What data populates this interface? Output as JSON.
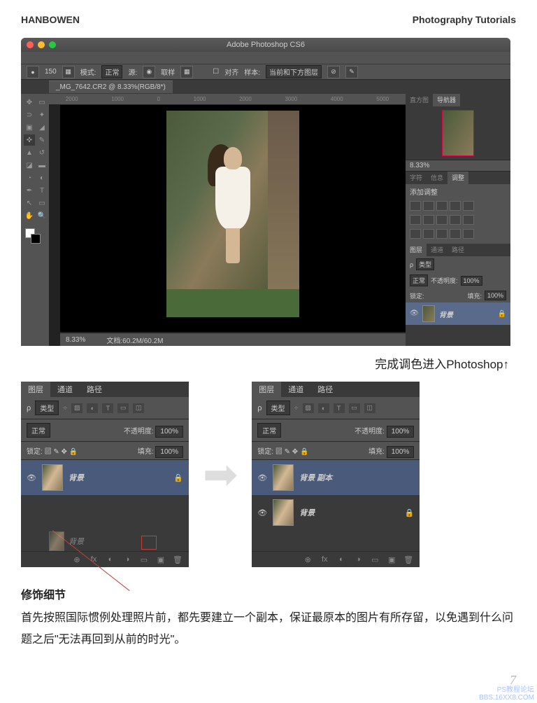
{
  "header": {
    "left": "HANBOWEN",
    "right": "Photography Tutorials"
  },
  "ps_window": {
    "title": "Adobe Photoshop CS6",
    "options": {
      "brush_size": "150",
      "mode_label": "模式:",
      "mode_value": "正常",
      "source_label": "源:",
      "sample_label": "取样",
      "align_label": "对齐",
      "sample_mode_label": "样本:",
      "sample_mode_value": "当前和下方图层"
    },
    "document_tab": "_MG_7642.CR2 @ 8.33%(RGB/8*)",
    "ruler_marks": [
      "2000",
      "1000",
      "0",
      "1000",
      "2000",
      "3000",
      "4000",
      "5000"
    ],
    "status": {
      "zoom": "8.33%",
      "docsize": "文档:60.2M/60.2M"
    },
    "panels": {
      "nav_tabs": [
        "直方图",
        "导航器"
      ],
      "nav_zoom": "8.33%",
      "info_tabs": [
        "字符",
        "信息",
        "调整"
      ],
      "adjust_title": "添加调整",
      "layer_tabs": [
        "图层",
        "通道",
        "路径"
      ],
      "filter_label": "类型",
      "blend": "正常",
      "opacity_label": "不透明度:",
      "opacity_value": "100%",
      "lock_label": "锁定:",
      "fill_label": "填充:",
      "fill_value": "100%",
      "layer_name": "背景"
    }
  },
  "caption": "完成调色进入Photoshop↑",
  "panel_left": {
    "tabs": [
      "图层",
      "通道",
      "路径"
    ],
    "filter_label": "类型",
    "blend": "正常",
    "opacity_label": "不透明度:",
    "opacity_value": "100%",
    "lock_label": "锁定:",
    "fill_label": "填充:",
    "fill_value": "100%",
    "layer1": "背景",
    "ghost": "背景"
  },
  "panel_right": {
    "tabs": [
      "图层",
      "通道",
      "路径"
    ],
    "filter_label": "类型",
    "blend": "正常",
    "opacity_label": "不透明度:",
    "opacity_value": "100%",
    "lock_label": "锁定:",
    "fill_label": "填充:",
    "fill_value": "100%",
    "layer1": "背景 副本",
    "layer2": "背景"
  },
  "body": {
    "heading": "修饰细节",
    "p1": "首先按照国际惯例处理照片前，都先要建立一个副本，保证最原本的图片有所存留，以免遇到什么问题之后\"无法再回到从前的时光\"。"
  },
  "page_number": "7",
  "watermark": {
    "l1": "PS教程论坛",
    "l2": "BBS.16XX8.COM"
  }
}
